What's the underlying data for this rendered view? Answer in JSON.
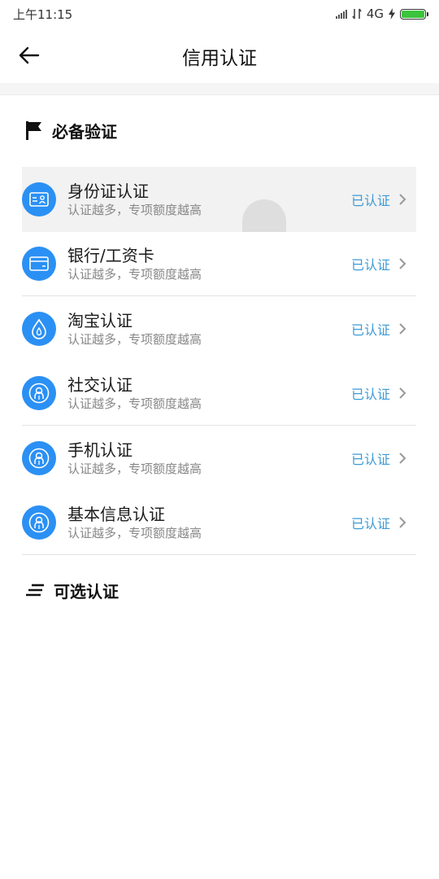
{
  "status_bar": {
    "time": "上午11:15",
    "network": "4G"
  },
  "header": {
    "title": "信用认证"
  },
  "sections": {
    "required": {
      "title": "必备验证"
    },
    "optional": {
      "title": "可选认证"
    }
  },
  "items": [
    {
      "title": "身份证认证",
      "subtitle": "认证越多，专项额度越高",
      "status": "已认证",
      "icon": "id-card-icon"
    },
    {
      "title": "银行/工资卡",
      "subtitle": "认证越多，专项额度越高",
      "status": "已认证",
      "icon": "bank-card-icon"
    },
    {
      "title": "淘宝认证",
      "subtitle": "认证越多，专项额度越高",
      "status": "已认证",
      "icon": "taobao-icon"
    },
    {
      "title": "社交认证",
      "subtitle": "认证越多，专项额度越高",
      "status": "已认证",
      "icon": "person-icon"
    },
    {
      "title": "手机认证",
      "subtitle": "认证越多，专项额度越高",
      "status": "已认证",
      "icon": "person-icon"
    },
    {
      "title": "基本信息认证",
      "subtitle": "认证越多，专项额度越高",
      "status": "已认证",
      "icon": "person-icon"
    }
  ],
  "colors": {
    "accent": "#2b90f4",
    "status_text": "#3d9bd6",
    "battery": "#3cc43c"
  }
}
